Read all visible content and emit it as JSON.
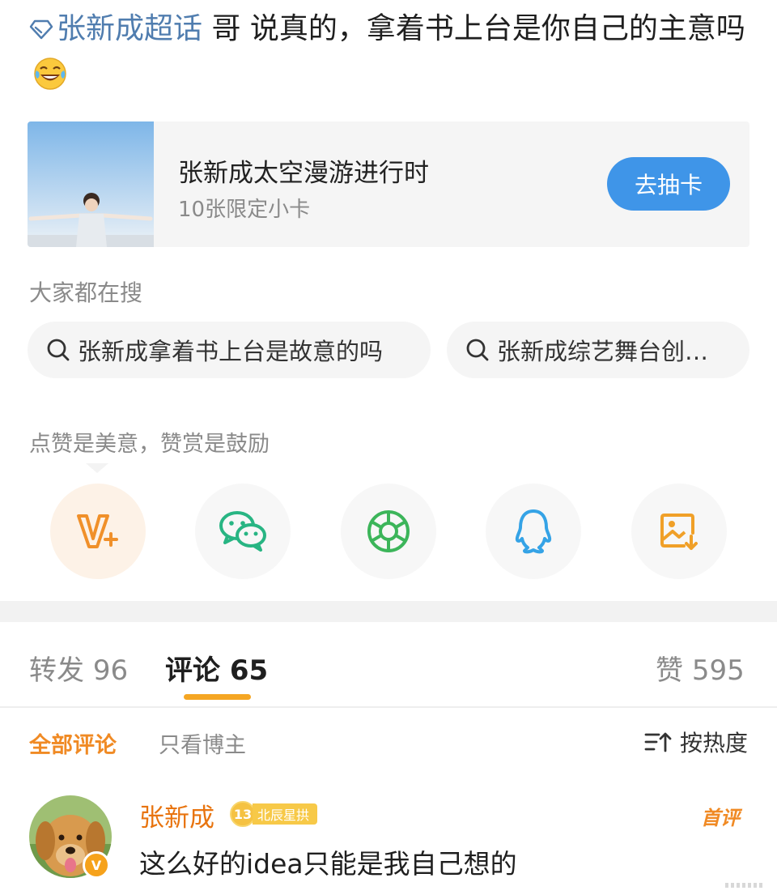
{
  "post": {
    "topic": "张新成超话",
    "text": " 哥 说真的，拿着书上台是你自己的主意吗",
    "emoji": "laughing-tears-emoji"
  },
  "card": {
    "title": "张新成太空漫游进行时",
    "subtitle": "10张限定小卡",
    "button": "去抽卡"
  },
  "search": {
    "label": "大家都在搜",
    "chips": [
      "张新成拿着书上台是故意的吗",
      "张新成综艺舞台创…"
    ]
  },
  "reward": {
    "label": "点赞是美意，赞赏是鼓励",
    "icons": [
      "v-plus-icon",
      "wechat-icon",
      "moments-icon",
      "qq-icon",
      "save-image-icon"
    ]
  },
  "tabs": {
    "repost_label": "转发",
    "repost_count": "96",
    "comment_label": "评论",
    "comment_count": "65",
    "like_label": "赞",
    "like_count": "595"
  },
  "filters": {
    "all": "全部评论",
    "host_only": "只看博主",
    "sort": "按热度"
  },
  "comment": {
    "user": "张新成",
    "level": "13",
    "fan_title": "北辰星拱",
    "badge": "首评",
    "text": "这么好的idea只能是我自己想的"
  },
  "colors": {
    "accent_orange": "#f08a24",
    "link_blue": "#507daf",
    "button_blue": "#3f95e8"
  }
}
